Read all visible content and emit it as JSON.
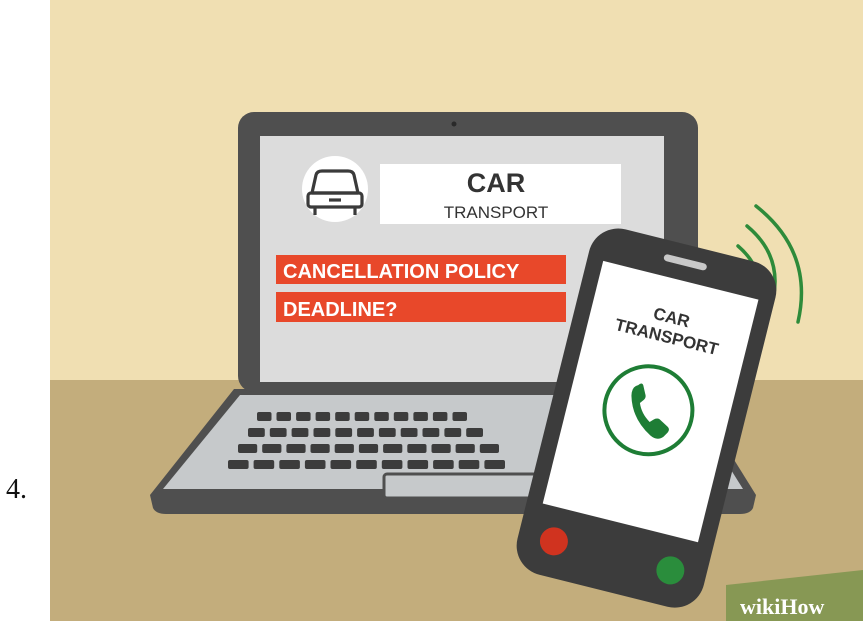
{
  "step_number": "4.",
  "laptop": {
    "heading_line1": "CAR",
    "heading_line2": "TRANSPORT",
    "highlight_line1": "CANCELLATION POLICY",
    "highlight_line2": "DEADLINE?",
    "car_icon": "car-front-icon"
  },
  "phone": {
    "caller_line1": "CAR",
    "caller_line2": "TRANSPORT",
    "call_icon": "phone-handset-icon"
  },
  "watermark": {
    "part1": "wiki",
    "part2": "How"
  },
  "colors": {
    "wall": "#f0dfb2",
    "desk": "#c3ad7c",
    "highlight": "#e8482a",
    "call_green": "#1e7d35",
    "decline_red": "#d0331f",
    "accept_green": "#2a8d3c",
    "signal_green": "#2e8b3a"
  }
}
